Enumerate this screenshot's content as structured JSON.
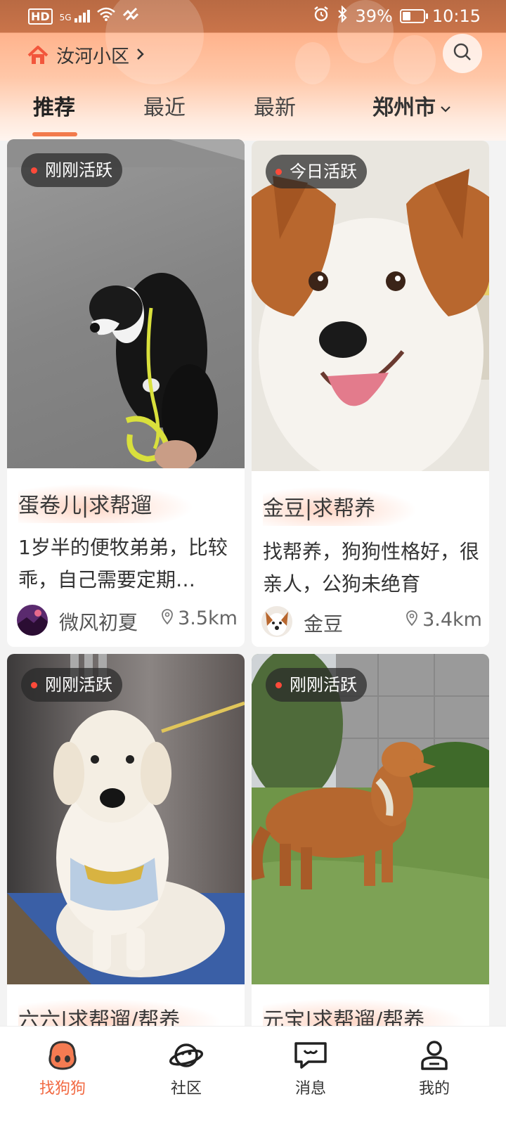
{
  "status_bar": {
    "network_label": "HD",
    "signal_label": "5G",
    "battery": "39%",
    "battery_level": 0.39,
    "time": "10:15"
  },
  "header": {
    "location": "汝河小区",
    "tabs": [
      {
        "label": "推荐",
        "active": true
      },
      {
        "label": "最近",
        "active": false
      },
      {
        "label": "最新",
        "active": false
      },
      {
        "label": "郑州市",
        "active": false
      }
    ]
  },
  "cards": [
    {
      "badge": "刚刚活跃",
      "title": "蛋卷儿|求帮遛",
      "desc": "1岁半的便牧弟弟，比较乖，自己需要定期…",
      "user": "微风初夏",
      "distance": "3.5km",
      "photo_icon": "border-collie-photo"
    },
    {
      "badge": "今日活跃",
      "title": "金豆|求帮养",
      "desc": "找帮养，狗狗性格好，很亲人，公狗未绝育",
      "user": "金豆",
      "distance": "3.4km",
      "photo_icon": "corgi-mix-photo"
    },
    {
      "badge": "刚刚活跃",
      "title": "六六|求帮遛/帮养",
      "photo_icon": "golden-retriever-elevator-photo"
    },
    {
      "badge": "刚刚活跃",
      "title": "元宝|求帮遛/帮养",
      "photo_icon": "golden-retriever-lawn-photo"
    }
  ],
  "bottom_nav": [
    {
      "label": "找狗狗",
      "icon": "dog-nose-icon",
      "active": true
    },
    {
      "label": "社区",
      "icon": "planet-icon",
      "active": false
    },
    {
      "label": "消息",
      "icon": "message-icon",
      "active": false
    },
    {
      "label": "我的",
      "icon": "profile-icon",
      "active": false
    }
  ],
  "colors": {
    "accent": "#f27a4b",
    "status_bar_bg": "#b96a43",
    "badge_dot": "#ff4a3a"
  }
}
